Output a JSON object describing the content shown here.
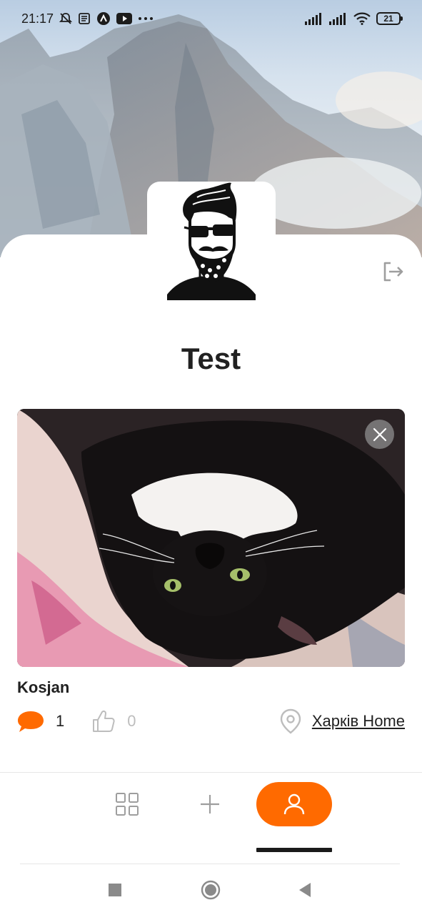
{
  "status_bar": {
    "time": "21:17",
    "icons": [
      "mute-bell-icon",
      "notes-icon",
      "app-icon",
      "youtube-icon",
      "more-dots-icon"
    ],
    "right_icons": [
      "signal-icon",
      "signal-icon",
      "wifi-icon"
    ],
    "battery": "21"
  },
  "profile": {
    "name": "Test",
    "avatar": "bearded-man-avatar",
    "logout_icon": "logout-icon"
  },
  "post": {
    "title": "Kosjan",
    "comments_count": "1",
    "likes_count": "0",
    "location": "Харків Home",
    "image": "cat-photo",
    "close_icon": "close-icon"
  },
  "colors": {
    "accent": "#ff6a00",
    "text": "#212121",
    "muted": "#bdbdbd"
  },
  "tabbar": {
    "items": [
      {
        "name": "grid",
        "icon": "grid-icon"
      },
      {
        "name": "add",
        "icon": "plus-icon"
      },
      {
        "name": "profile",
        "icon": "user-icon",
        "active": true
      }
    ]
  },
  "system_nav": [
    "recents-square-icon",
    "home-circle-icon",
    "back-triangle-icon"
  ]
}
